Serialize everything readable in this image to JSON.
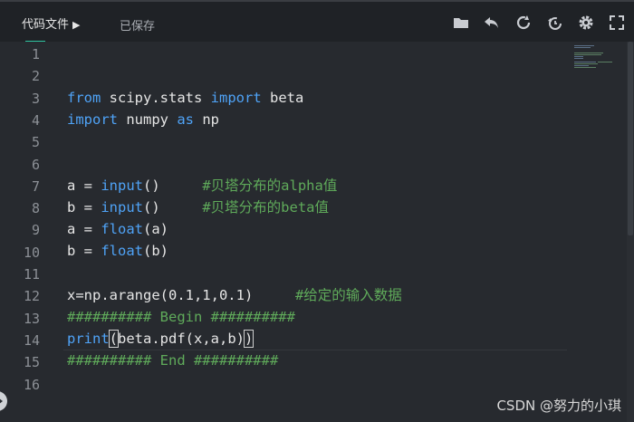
{
  "header": {
    "active_tab": "代码文件",
    "active_tab_arrow": "▶",
    "save_status": "已保存"
  },
  "toolbar": {
    "icons": [
      "folder-icon",
      "undo-icon",
      "refresh-icon",
      "history-icon",
      "gear-icon",
      "fullscreen-icon"
    ]
  },
  "editor": {
    "line_numbers": [
      "1",
      "2",
      "3",
      "4",
      "5",
      "6",
      "7",
      "8",
      "9",
      "10",
      "11",
      "12",
      "13",
      "14",
      "15",
      "16"
    ],
    "lines": {
      "l3": [
        {
          "t": "from",
          "c": "kw"
        },
        {
          "t": " scipy.stats ",
          "c": ""
        },
        {
          "t": "import",
          "c": "kw"
        },
        {
          "t": " beta",
          "c": ""
        }
      ],
      "l4": [
        {
          "t": "import",
          "c": "kw"
        },
        {
          "t": " numpy ",
          "c": ""
        },
        {
          "t": "as",
          "c": "kw"
        },
        {
          "t": " np",
          "c": ""
        }
      ],
      "l7": [
        {
          "t": "a = ",
          "c": ""
        },
        {
          "t": "input",
          "c": "fn"
        },
        {
          "t": "()     ",
          "c": ""
        },
        {
          "t": "#贝塔分布的alpha值",
          "c": "cm"
        }
      ],
      "l8": [
        {
          "t": "b = ",
          "c": ""
        },
        {
          "t": "input",
          "c": "fn"
        },
        {
          "t": "()     ",
          "c": ""
        },
        {
          "t": "#贝塔分布的beta值",
          "c": "cm"
        }
      ],
      "l9": [
        {
          "t": "a = ",
          "c": ""
        },
        {
          "t": "float",
          "c": "fn"
        },
        {
          "t": "(a)",
          "c": ""
        }
      ],
      "l10": [
        {
          "t": "b = ",
          "c": ""
        },
        {
          "t": "float",
          "c": "fn"
        },
        {
          "t": "(b)",
          "c": ""
        }
      ],
      "l12": [
        {
          "t": "x=np.arange(0.1,1,0.1)     ",
          "c": ""
        },
        {
          "t": "#给定的输入数据",
          "c": "cm"
        }
      ],
      "l13": [
        {
          "t": "########## Begin ##########",
          "c": "cm"
        }
      ],
      "l14": [
        {
          "t": "print",
          "c": "fn"
        },
        {
          "t": "(",
          "c": "bracket"
        },
        {
          "t": "beta.pdf(x,a,b)",
          "c": ""
        },
        {
          "t": ")",
          "c": "bracket"
        }
      ],
      "l15": [
        {
          "t": "########## End ##########",
          "c": "cm"
        }
      ]
    }
  },
  "watermark": "CSDN @努力的小琪",
  "colors": {
    "background": "#272a2f",
    "topbar": "#1f2226",
    "keyword": "#4fa3f7",
    "comment": "#5faa5a",
    "accent": "#2ec4a0"
  }
}
